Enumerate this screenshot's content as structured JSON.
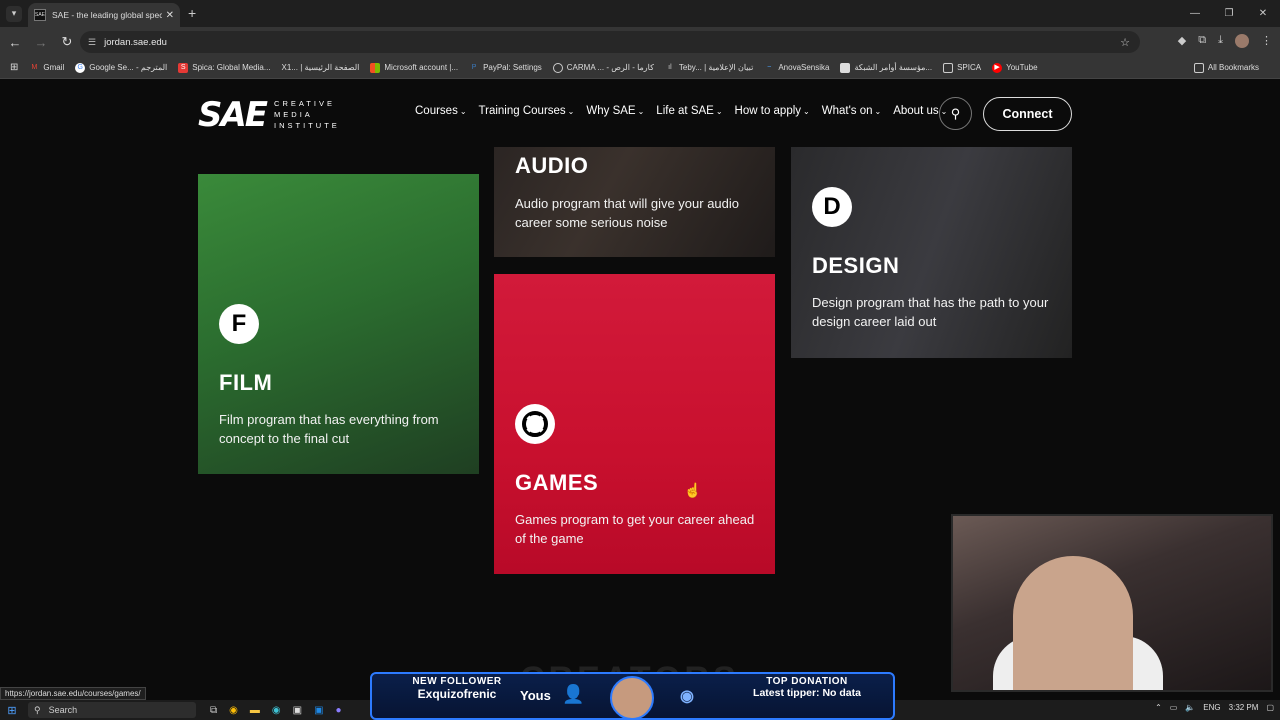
{
  "browser": {
    "tab_title": "SAE - the leading global speciali",
    "url": "jordan.sae.edu",
    "status_url": "https://jordan.sae.edu/courses/games/",
    "bookmarks": [
      "Gmail",
      "Google Se... - المترجم",
      "Spica: Global Media...",
      "X1... | الصفحة الرئيسية",
      "Microsoft account |...",
      "PayPal: Settings",
      "CARMA ... - كارما - الرص",
      "Teby... | تبيان الإعلامية",
      "AnovaSensika",
      "مؤسسة أوامر الشبكة...",
      "SPICA",
      "YouTube"
    ],
    "all_bookmarks": "All Bookmarks"
  },
  "site": {
    "logo_mark": "SAE",
    "logo_lines": [
      "CREATIVE",
      "MEDIA",
      "INSTITUTE"
    ],
    "nav": [
      "Courses",
      "Training Courses",
      "Why SAE",
      "Life at SAE",
      "How to apply",
      "What's on",
      "About us"
    ],
    "connect": "Connect",
    "cards": {
      "audio": {
        "title": "AUDIO",
        "desc": "Audio program that will give your audio career some serious noise"
      },
      "film": {
        "title": "FILM",
        "desc": "Film program that has everything from concept to the final cut",
        "badge": "F"
      },
      "games": {
        "title": "GAMES",
        "desc": "Games program to get your career ahead of the game"
      },
      "design": {
        "title": "DESIGN",
        "desc": "Design program that has the path to your design career laid out",
        "badge": "D"
      }
    },
    "next_section_heading": "CREATORS"
  },
  "stream": {
    "new_follower_label": "NEW FOLLOWER",
    "new_follower_name": "Exquizofrenic",
    "you_label": "Yous",
    "top_donation_label": "TOP DONATION",
    "top_donation_value": "Latest tipper: No data"
  },
  "taskbar": {
    "search": "Search",
    "lang": "ENG",
    "time": "3:32 PM"
  }
}
